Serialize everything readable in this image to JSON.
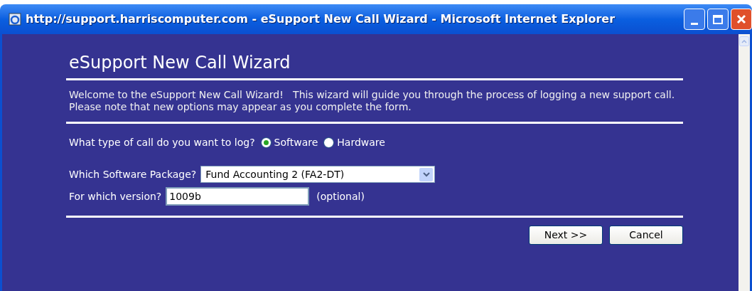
{
  "window": {
    "title": "http://support.harriscomputer.com - eSupport New Call Wizard - Microsoft Internet Explorer"
  },
  "heading": "eSupport New Call Wizard",
  "intro": [
    "Welcome to the eSupport New Call Wizard!   This wizard will guide you through the process of logging a new support call.",
    "Please note that new options may appear as you complete the form."
  ],
  "call_type": {
    "label": "What type of call do you want to log?",
    "options": [
      {
        "label": "Software",
        "selected": true
      },
      {
        "label": "Hardware",
        "selected": false
      }
    ]
  },
  "package": {
    "label": "Which Software Package?",
    "value": "Fund Accounting 2 (FA2-DT)"
  },
  "version": {
    "label": "For which version?",
    "value": "1009b",
    "note": "(optional)"
  },
  "buttons": [
    "Next >>",
    "Cancel"
  ]
}
